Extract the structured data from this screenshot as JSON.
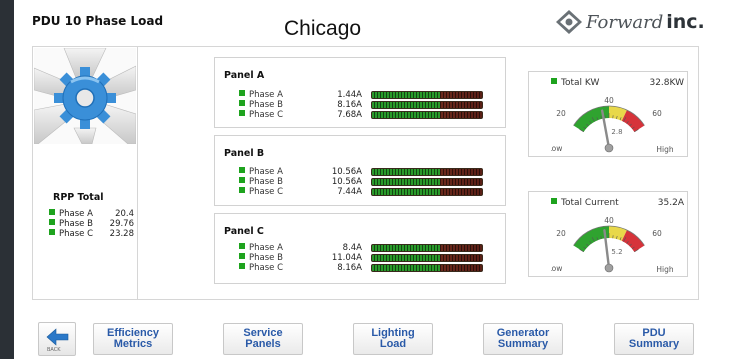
{
  "header": {
    "title": "PDU 10 Phase Load",
    "city": "Chicago",
    "logo_text_1": "Forward",
    "logo_text_2": "inc."
  },
  "rpp": {
    "title": "RPP Total",
    "phases": [
      {
        "label": "Phase A",
        "value": "20.4"
      },
      {
        "label": "Phase B",
        "value": "29.76"
      },
      {
        "label": "Phase C",
        "value": "23.28"
      }
    ]
  },
  "panels": [
    {
      "title": "Panel A",
      "phases": [
        {
          "label": "Phase A",
          "value": "1.44A",
          "level": 0.62
        },
        {
          "label": "Phase B",
          "value": "8.16A",
          "level": 0.62
        },
        {
          "label": "Phase C",
          "value": "7.68A",
          "level": 0.62
        }
      ]
    },
    {
      "title": "Panel B",
      "phases": [
        {
          "label": "Phase A",
          "value": "10.56A",
          "level": 0.62
        },
        {
          "label": "Phase B",
          "value": "10.56A",
          "level": 0.62
        },
        {
          "label": "Phase C",
          "value": "7.44A",
          "level": 0.62
        }
      ]
    },
    {
      "title": "Panel C",
      "phases": [
        {
          "label": "Phase A",
          "value": "8.4A",
          "level": 0.62
        },
        {
          "label": "Phase B",
          "value": "11.04A",
          "level": 0.62
        },
        {
          "label": "Phase C",
          "value": "8.16A",
          "level": 0.62
        }
      ]
    }
  ],
  "gauges": [
    {
      "label": "Total KW",
      "value": "32.8KW",
      "needle_value": 32.8,
      "ticks": {
        "low": "Low",
        "t20": "20",
        "t40": "40",
        "t60": "60",
        "high": "High"
      },
      "center_label": "2.8"
    },
    {
      "label": "Total Current",
      "value": "35.2A",
      "needle_value": 35.2,
      "ticks": {
        "low": "Low",
        "t20": "20",
        "t40": "40",
        "t60": "60",
        "high": "High"
      },
      "center_label": "5.2"
    }
  ],
  "nav": {
    "back_label": "BACK",
    "buttons": [
      {
        "line1": "Efficiency",
        "line2": "Metrics"
      },
      {
        "line1": "Service",
        "line2": "Panels"
      },
      {
        "line1": "Lighting",
        "line2": "Load"
      },
      {
        "line1": "Generator",
        "line2": "Summary"
      },
      {
        "line1": "PDU",
        "line2": "Summary"
      }
    ]
  },
  "colors": {
    "status_green": "#1ea31e",
    "nav_text": "#2a5aa8",
    "gauge_green": "#2fa32f",
    "gauge_yellow": "#e8d84a",
    "gauge_red": "#d6333a"
  }
}
